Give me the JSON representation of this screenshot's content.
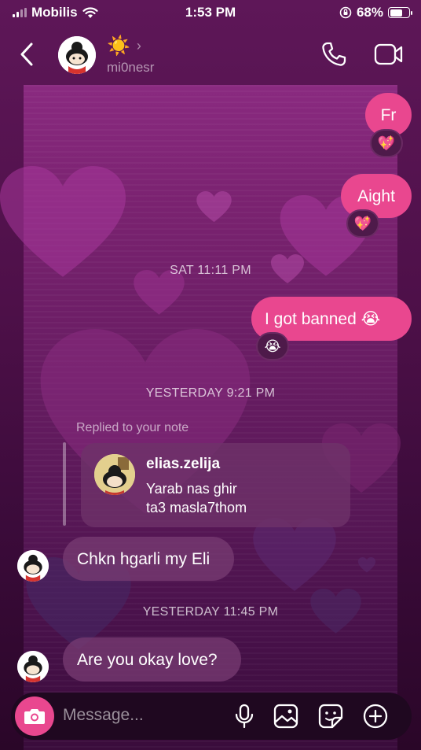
{
  "status_bar": {
    "carrier": "Mobilis",
    "time": "1:53 PM",
    "battery": "68%",
    "battery_level": 0.68
  },
  "header": {
    "display_name": "☀️",
    "username": "mi0nesr"
  },
  "messages": [
    {
      "text": "Fr",
      "reaction": "💖"
    },
    {
      "text": "Aight",
      "reaction": "💖"
    },
    {
      "timestamp": "SAT 11:11 PM"
    },
    {
      "text": "I got banned 😭",
      "reaction": "😭"
    },
    {
      "timestamp": "YESTERDAY 9:21 PM"
    }
  ],
  "note_reply": {
    "label": "Replied to your note",
    "note_username": "elias.zelija",
    "note_text": "Yarab nas ghir\nta3 masla7thom"
  },
  "incoming": [
    {
      "text": "Chkn hgarli my Eli"
    },
    {
      "timestamp": "YESTERDAY 11:45 PM"
    },
    {
      "text": "Are you okay love?"
    }
  ],
  "composer": {
    "placeholder": "Message..."
  },
  "icons": [
    "back-icon",
    "call-icon",
    "video-icon",
    "camera-icon",
    "microphone-icon",
    "gallery-icon",
    "sticker-icon",
    "plus-icon"
  ],
  "colors": {
    "outgoing_bubble": "#e9478f",
    "camera_button": "#e9478f"
  }
}
